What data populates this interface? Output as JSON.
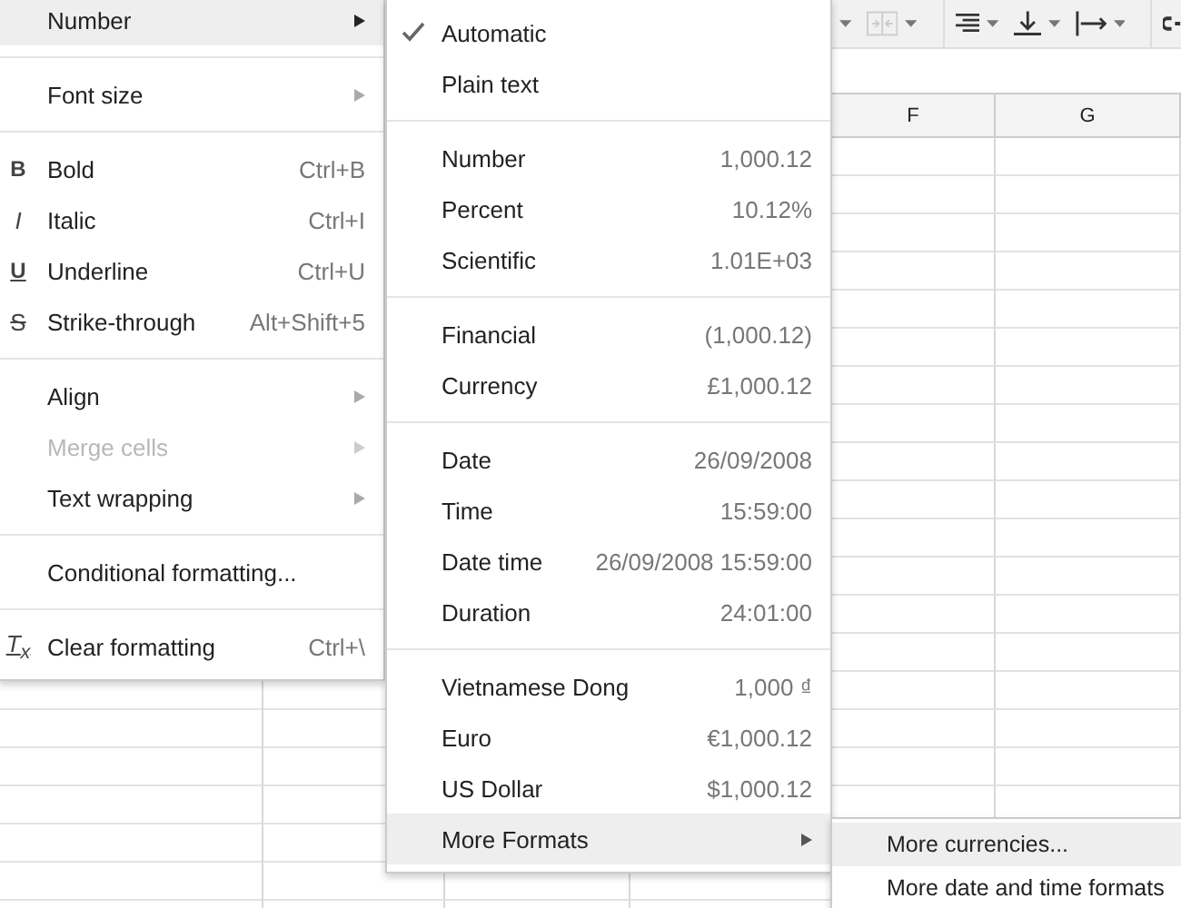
{
  "sheet": {
    "visible_columns": [
      "F",
      "G"
    ]
  },
  "format_menu": {
    "groups": [
      [
        {
          "label": "Number",
          "submenu": true,
          "disabled": false,
          "selected": true
        }
      ],
      [
        {
          "label": "Font size",
          "submenu": true,
          "disabled": false,
          "selected": false
        }
      ],
      [
        {
          "label": "Bold",
          "icon": "B",
          "kind": "bold",
          "shortcut": "Ctrl+B",
          "submenu": false,
          "disabled": false,
          "selected": false
        },
        {
          "label": "Italic",
          "icon": "I",
          "kind": "italic",
          "shortcut": "Ctrl+I",
          "submenu": false,
          "disabled": false,
          "selected": false
        },
        {
          "label": "Underline",
          "icon": "U",
          "kind": "underline",
          "shortcut": "Ctrl+U",
          "submenu": false,
          "disabled": false,
          "selected": false
        },
        {
          "label": "Strike-through",
          "icon": "S",
          "kind": "strike",
          "shortcut": "Alt+Shift+5",
          "submenu": false,
          "disabled": false,
          "selected": false
        }
      ],
      [
        {
          "label": "Align",
          "submenu": true,
          "disabled": false,
          "selected": false
        },
        {
          "label": "Merge cells",
          "submenu": true,
          "disabled": true,
          "selected": false
        },
        {
          "label": "Text wrapping",
          "submenu": true,
          "disabled": false,
          "selected": false
        }
      ],
      [
        {
          "label": "Conditional formatting...",
          "submenu": false,
          "disabled": false,
          "selected": false
        }
      ],
      [
        {
          "label": "Clear formatting",
          "icon": "T$_{x}$",
          "kind": "clear",
          "shortcut": "Ctrl+\\",
          "submenu": false,
          "disabled": false,
          "selected": false
        }
      ]
    ]
  },
  "number_menu": {
    "groups": [
      [
        {
          "label": "Automatic",
          "checked": true,
          "submenu": false,
          "selected": false
        },
        {
          "label": "Plain text",
          "checked": false,
          "submenu": false,
          "selected": false
        }
      ],
      [
        {
          "label": "Number",
          "sample": "1,000.12",
          "checked": false,
          "submenu": false,
          "selected": false
        },
        {
          "label": "Percent",
          "sample": "10.12%",
          "checked": false,
          "submenu": false,
          "selected": false
        },
        {
          "label": "Scientific",
          "sample": "1.01E+03",
          "checked": false,
          "submenu": false,
          "selected": false
        }
      ],
      [
        {
          "label": "Financial",
          "sample": "(1,000.12)",
          "checked": false,
          "submenu": false,
          "selected": false
        },
        {
          "label": "Currency",
          "sample": "£1,000.12",
          "checked": false,
          "submenu": false,
          "selected": false
        }
      ],
      [
        {
          "label": "Date",
          "sample": "26/09/2008",
          "checked": false,
          "submenu": false,
          "selected": false
        },
        {
          "label": "Time",
          "sample": "15:59:00",
          "checked": false,
          "submenu": false,
          "selected": false
        },
        {
          "label": "Date time",
          "sample": "26/09/2008 15:59:00",
          "checked": false,
          "submenu": false,
          "selected": false
        },
        {
          "label": "Duration",
          "sample": "24:01:00",
          "checked": false,
          "submenu": false,
          "selected": false
        }
      ],
      [
        {
          "label": "Vietnamese Dong",
          "sample": "1,000 ₫",
          "checked": false,
          "submenu": false,
          "selected": false
        },
        {
          "label": "Euro",
          "sample": "€1,000.12",
          "checked": false,
          "submenu": false,
          "selected": false
        },
        {
          "label": "US Dollar",
          "sample": "$1,000.12",
          "checked": false,
          "submenu": false,
          "selected": false
        },
        {
          "label": "More Formats",
          "checked": false,
          "submenu": true,
          "selected": true
        }
      ]
    ]
  },
  "more_formats_menu": {
    "items": [
      {
        "label": "More currencies...",
        "selected": true
      },
      {
        "label": "More date and time formats",
        "selected": false
      }
    ]
  }
}
